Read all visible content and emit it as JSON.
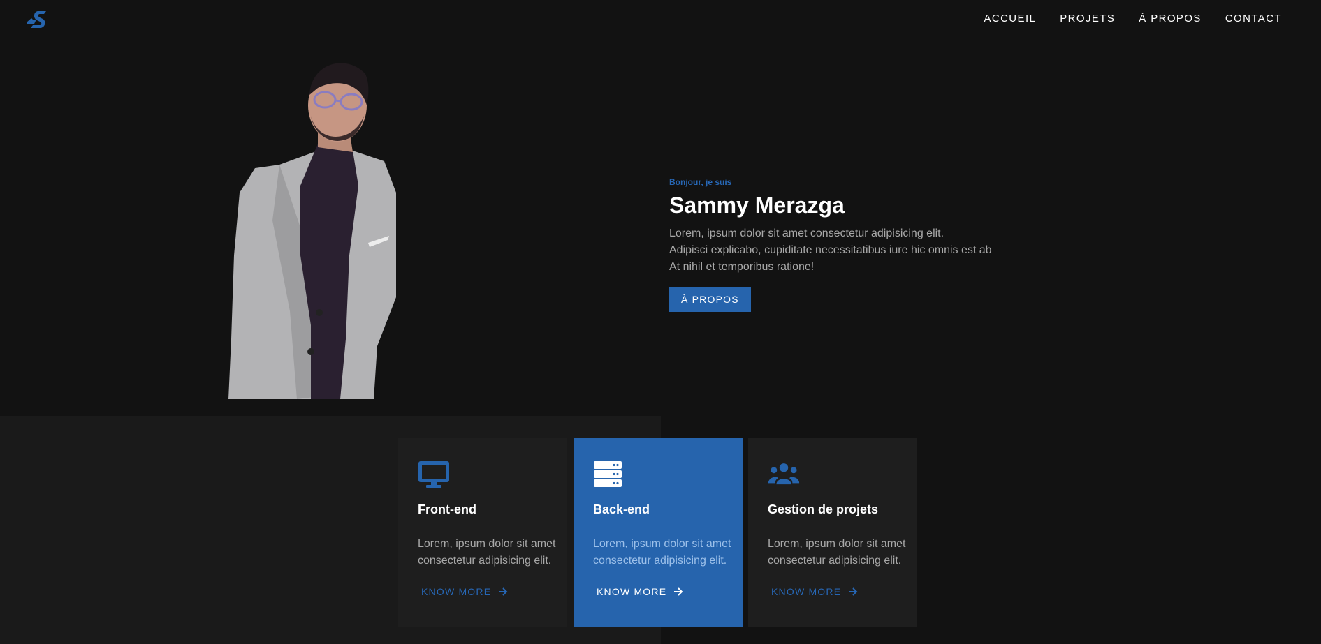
{
  "nav": {
    "logo_icon": "s-logo-icon",
    "items": [
      "ACCUEIL",
      "PROJETS",
      "À PROPOS",
      "CONTACT"
    ]
  },
  "hero": {
    "greeting": "Bonjour, je suis",
    "name": "Sammy Merazga",
    "lines": [
      "Lorem, ipsum dolor sit amet consectetur adipisicing elit.",
      "Adipisci explicabo, cupiditate necessitatibus iure hic omnis est ab",
      "At nihil et temporibus ratione!"
    ],
    "button": "À PROPOS"
  },
  "services": [
    {
      "icon": "desktop-icon",
      "title": "Front-end",
      "lines": [
        "Lorem, ipsum dolor sit amet",
        "consectetur adipisicing elit."
      ],
      "link": "KNOW MORE"
    },
    {
      "icon": "server-icon",
      "title": "Back-end",
      "lines": [
        "Lorem, ipsum dolor sit amet",
        "consectetur adipisicing elit."
      ],
      "link": "KNOW MORE"
    },
    {
      "icon": "users-icon",
      "title": "Gestion de projets",
      "lines": [
        "Lorem, ipsum dolor sit amet",
        "consectetur adipisicing elit."
      ],
      "link": "KNOW MORE"
    }
  ],
  "colors": {
    "accent": "#2664ad",
    "background": "#121212",
    "card": "#1e1e1e",
    "muted_text": "#a8a8a8"
  }
}
